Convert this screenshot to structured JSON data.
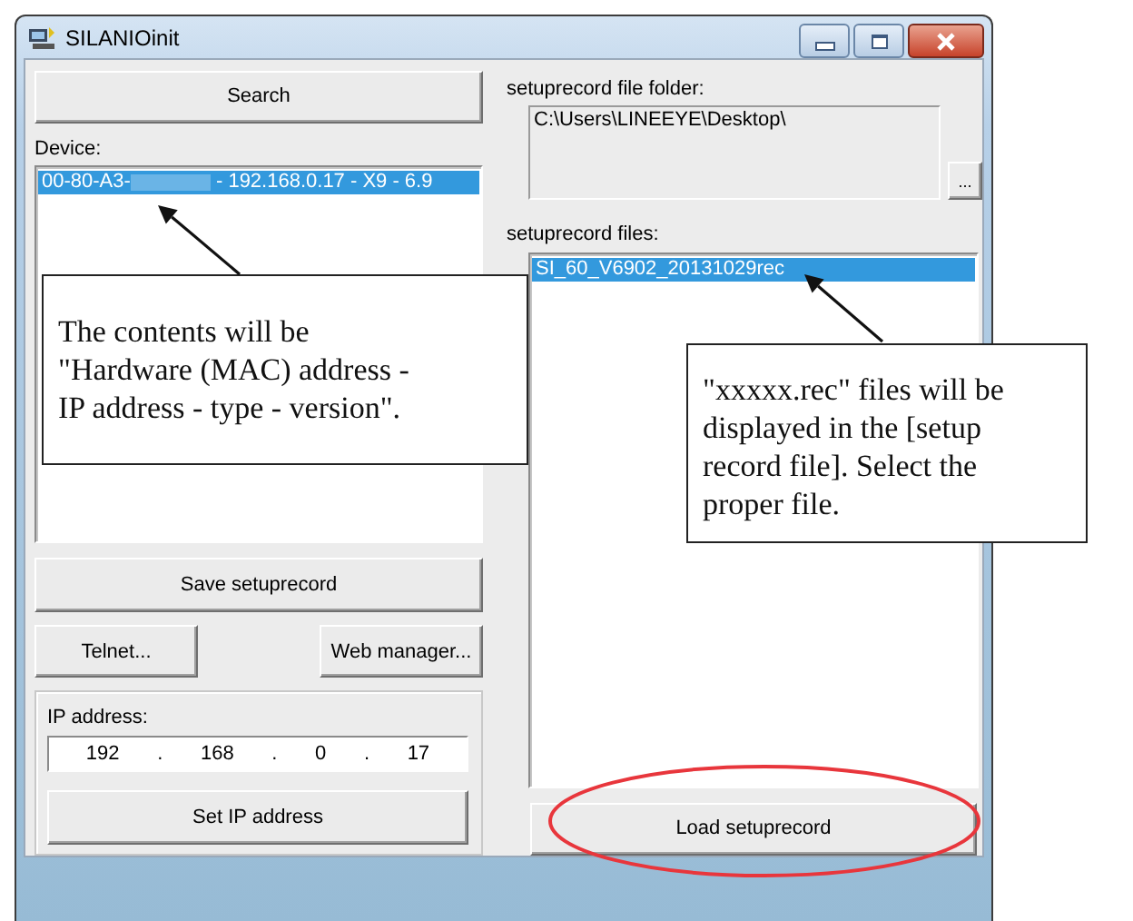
{
  "window": {
    "title": "SILANIOinit"
  },
  "left": {
    "search_button": "Search",
    "device_label": "Device:",
    "devices": [
      {
        "text_before": "00-80-A3-",
        "text_after": " - 192.168.0.17 - X9 - 6.9",
        "redacted": true,
        "selected": true
      }
    ],
    "save_button": "Save setuprecord",
    "telnet_button": "Telnet...",
    "web_button": "Web manager...",
    "ip": {
      "label": "IP address:",
      "octets": [
        "192",
        "168",
        "0",
        "17"
      ],
      "separators": [
        ".",
        ".",
        "."
      ]
    },
    "set_ip_button": "Set IP address"
  },
  "right": {
    "folder_label": "setuprecord file folder:",
    "folder_value": "C:\\Users\\LINEEYE\\Desktop\\",
    "browse_button": "...",
    "files_label": "setuprecord files:",
    "files": [
      {
        "name": "SI_60_V6902_20131029rec",
        "selected": true
      }
    ],
    "load_button": "Load setuprecord"
  },
  "callouts": [
    {
      "text": "The contents will be\n\"Hardware (MAC) address -\nIP address - type - version\"."
    },
    {
      "text": "\"xxxxx.rec\" files will be\ndisplayed in the [setup\nrecord file]. Select the\nproper file."
    }
  ]
}
